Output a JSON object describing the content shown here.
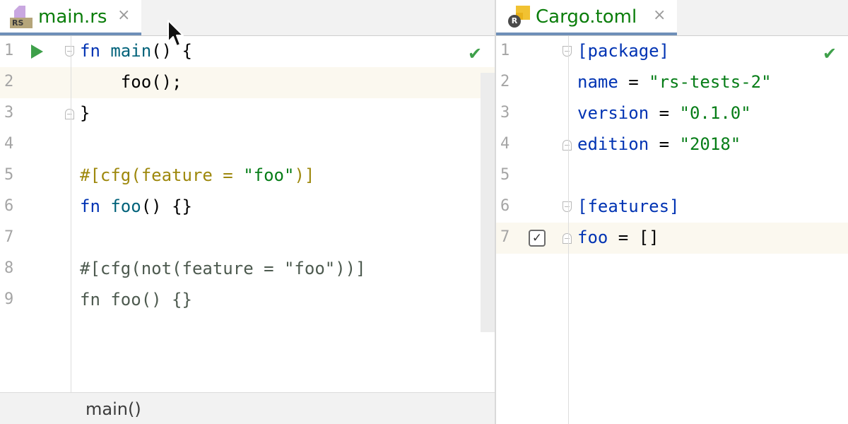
{
  "left_editor": {
    "tab": {
      "icon": "rust-file-icon",
      "badge": "RS",
      "label": "main.rs",
      "close": "×"
    },
    "lines": [
      {
        "n": "1",
        "tokens": [
          [
            "kw",
            "fn"
          ],
          [
            "",
            " "
          ],
          [
            "fn",
            "main"
          ],
          [
            "",
            "() {"
          ]
        ]
      },
      {
        "n": "2",
        "tokens": [
          [
            "",
            "    foo();"
          ]
        ]
      },
      {
        "n": "3",
        "tokens": [
          [
            "",
            "}"
          ]
        ]
      },
      {
        "n": "4",
        "tokens": []
      },
      {
        "n": "5",
        "tokens": [
          [
            "attr",
            "#[cfg(feature = "
          ],
          [
            "str",
            "\"foo\""
          ],
          [
            "attr",
            ")]"
          ]
        ]
      },
      {
        "n": "6",
        "tokens": [
          [
            "kw",
            "fn"
          ],
          [
            "",
            " "
          ],
          [
            "fn",
            "foo"
          ],
          [
            "",
            "() {}"
          ]
        ]
      },
      {
        "n": "7",
        "tokens": []
      },
      {
        "n": "8",
        "tokens": [
          [
            "dim",
            "#[cfg(not(feature = \"foo\"))]"
          ]
        ]
      },
      {
        "n": "9",
        "tokens": [
          [
            "dim",
            "fn foo() {}"
          ]
        ]
      }
    ],
    "breadcrumb": "main()"
  },
  "right_editor": {
    "tab": {
      "icon": "cargo-file-icon",
      "gear_letter": "R",
      "label": "Cargo.toml",
      "close": "×"
    },
    "lines": [
      {
        "n": "1",
        "tokens": [
          [
            "sec",
            "[package]"
          ]
        ]
      },
      {
        "n": "2",
        "tokens": [
          [
            "key",
            "name"
          ],
          [
            "",
            ""
          ],
          [
            "",
            ""
          ],
          [
            "",
            " = "
          ],
          [
            "str",
            "\"rs-tests-2\""
          ]
        ]
      },
      {
        "n": "3",
        "tokens": [
          [
            "key",
            "version"
          ],
          [
            "",
            " = "
          ],
          [
            "str",
            "\"0.1.0\""
          ]
        ]
      },
      {
        "n": "4",
        "tokens": [
          [
            "key",
            "edition"
          ],
          [
            "",
            " = "
          ],
          [
            "str",
            "\"2018\""
          ]
        ]
      },
      {
        "n": "5",
        "tokens": []
      },
      {
        "n": "6",
        "tokens": [
          [
            "sec",
            "[features]"
          ]
        ]
      },
      {
        "n": "7",
        "tokens": [
          [
            "key",
            "foo"
          ],
          [
            "",
            " = []"
          ]
        ]
      }
    ],
    "feature_checkbox": "✓"
  },
  "status": {
    "inspection_ok": "✔"
  },
  "colors": {
    "tab_active_text": "#0a7d0a",
    "keyword": "#0033b3",
    "string": "#067d17",
    "attribute": "#9e880d",
    "run_green": "#3ea04a",
    "current_line": "#fbf8ef"
  }
}
